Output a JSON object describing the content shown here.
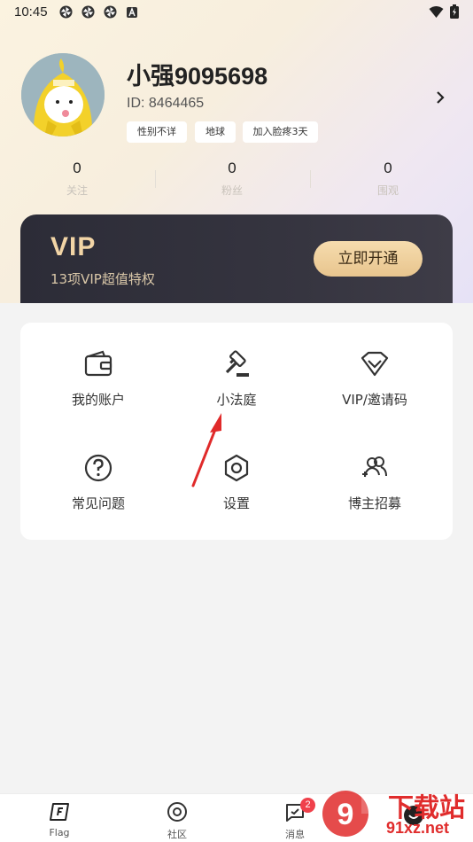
{
  "status_bar": {
    "time": "10:45",
    "icons": [
      "pinwheel-icon",
      "pinwheel-icon",
      "pinwheel-icon",
      "a-badge-icon",
      "wifi-icon",
      "battery-icon"
    ]
  },
  "profile": {
    "username": "小强9095698",
    "id_text": "ID: 8464465",
    "tags": [
      "性别不详",
      "地球",
      "加入脸疼3天"
    ],
    "stats": [
      {
        "value": "0",
        "label": "关注"
      },
      {
        "value": "0",
        "label": "粉丝"
      },
      {
        "value": "0",
        "label": "围观"
      }
    ]
  },
  "vip": {
    "title": "VIP",
    "subtitle": "13项VIP超值特权",
    "button": "立即开通",
    "colors": {
      "text": "#f2d5a6",
      "button": "#f0d29f",
      "card": "#2f2e39"
    }
  },
  "menu": {
    "items": [
      {
        "label": "我的账户",
        "icon": "wallet-icon"
      },
      {
        "label": "小法庭",
        "icon": "gavel-icon"
      },
      {
        "label": "VIP/邀请码",
        "icon": "diamond-icon"
      },
      {
        "label": "常见问题",
        "icon": "question-icon"
      },
      {
        "label": "设置",
        "icon": "hexagon-settings-icon"
      },
      {
        "label": "博主招募",
        "icon": "users-add-icon"
      }
    ]
  },
  "bottom_nav": {
    "items": [
      {
        "label": "Flag",
        "icon": "flag-f-icon"
      },
      {
        "label": "社区",
        "icon": "community-target-icon"
      },
      {
        "label": "消息",
        "icon": "message-icon",
        "badge": "2"
      },
      {
        "label": "",
        "icon": "profile-face-icon"
      }
    ]
  },
  "watermark": {
    "top": "下载站",
    "bottom": "91xz.net",
    "color": "#e02c2c"
  }
}
